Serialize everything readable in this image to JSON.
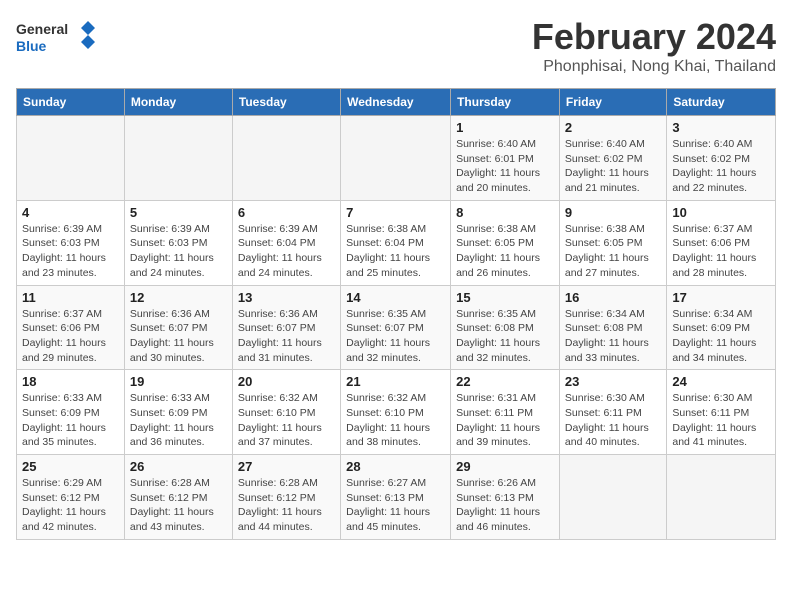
{
  "header": {
    "logo_general": "General",
    "logo_blue": "Blue",
    "title": "February 2024",
    "subtitle": "Phonphisai, Nong Khai, Thailand"
  },
  "weekdays": [
    "Sunday",
    "Monday",
    "Tuesday",
    "Wednesday",
    "Thursday",
    "Friday",
    "Saturday"
  ],
  "weeks": [
    [
      {
        "day": "",
        "detail": ""
      },
      {
        "day": "",
        "detail": ""
      },
      {
        "day": "",
        "detail": ""
      },
      {
        "day": "",
        "detail": ""
      },
      {
        "day": "1",
        "detail": "Sunrise: 6:40 AM\nSunset: 6:01 PM\nDaylight: 11 hours\nand 20 minutes."
      },
      {
        "day": "2",
        "detail": "Sunrise: 6:40 AM\nSunset: 6:02 PM\nDaylight: 11 hours\nand 21 minutes."
      },
      {
        "day": "3",
        "detail": "Sunrise: 6:40 AM\nSunset: 6:02 PM\nDaylight: 11 hours\nand 22 minutes."
      }
    ],
    [
      {
        "day": "4",
        "detail": "Sunrise: 6:39 AM\nSunset: 6:03 PM\nDaylight: 11 hours\nand 23 minutes."
      },
      {
        "day": "5",
        "detail": "Sunrise: 6:39 AM\nSunset: 6:03 PM\nDaylight: 11 hours\nand 24 minutes."
      },
      {
        "day": "6",
        "detail": "Sunrise: 6:39 AM\nSunset: 6:04 PM\nDaylight: 11 hours\nand 24 minutes."
      },
      {
        "day": "7",
        "detail": "Sunrise: 6:38 AM\nSunset: 6:04 PM\nDaylight: 11 hours\nand 25 minutes."
      },
      {
        "day": "8",
        "detail": "Sunrise: 6:38 AM\nSunset: 6:05 PM\nDaylight: 11 hours\nand 26 minutes."
      },
      {
        "day": "9",
        "detail": "Sunrise: 6:38 AM\nSunset: 6:05 PM\nDaylight: 11 hours\nand 27 minutes."
      },
      {
        "day": "10",
        "detail": "Sunrise: 6:37 AM\nSunset: 6:06 PM\nDaylight: 11 hours\nand 28 minutes."
      }
    ],
    [
      {
        "day": "11",
        "detail": "Sunrise: 6:37 AM\nSunset: 6:06 PM\nDaylight: 11 hours\nand 29 minutes."
      },
      {
        "day": "12",
        "detail": "Sunrise: 6:36 AM\nSunset: 6:07 PM\nDaylight: 11 hours\nand 30 minutes."
      },
      {
        "day": "13",
        "detail": "Sunrise: 6:36 AM\nSunset: 6:07 PM\nDaylight: 11 hours\nand 31 minutes."
      },
      {
        "day": "14",
        "detail": "Sunrise: 6:35 AM\nSunset: 6:07 PM\nDaylight: 11 hours\nand 32 minutes."
      },
      {
        "day": "15",
        "detail": "Sunrise: 6:35 AM\nSunset: 6:08 PM\nDaylight: 11 hours\nand 32 minutes."
      },
      {
        "day": "16",
        "detail": "Sunrise: 6:34 AM\nSunset: 6:08 PM\nDaylight: 11 hours\nand 33 minutes."
      },
      {
        "day": "17",
        "detail": "Sunrise: 6:34 AM\nSunset: 6:09 PM\nDaylight: 11 hours\nand 34 minutes."
      }
    ],
    [
      {
        "day": "18",
        "detail": "Sunrise: 6:33 AM\nSunset: 6:09 PM\nDaylight: 11 hours\nand 35 minutes."
      },
      {
        "day": "19",
        "detail": "Sunrise: 6:33 AM\nSunset: 6:09 PM\nDaylight: 11 hours\nand 36 minutes."
      },
      {
        "day": "20",
        "detail": "Sunrise: 6:32 AM\nSunset: 6:10 PM\nDaylight: 11 hours\nand 37 minutes."
      },
      {
        "day": "21",
        "detail": "Sunrise: 6:32 AM\nSunset: 6:10 PM\nDaylight: 11 hours\nand 38 minutes."
      },
      {
        "day": "22",
        "detail": "Sunrise: 6:31 AM\nSunset: 6:11 PM\nDaylight: 11 hours\nand 39 minutes."
      },
      {
        "day": "23",
        "detail": "Sunrise: 6:30 AM\nSunset: 6:11 PM\nDaylight: 11 hours\nand 40 minutes."
      },
      {
        "day": "24",
        "detail": "Sunrise: 6:30 AM\nSunset: 6:11 PM\nDaylight: 11 hours\nand 41 minutes."
      }
    ],
    [
      {
        "day": "25",
        "detail": "Sunrise: 6:29 AM\nSunset: 6:12 PM\nDaylight: 11 hours\nand 42 minutes."
      },
      {
        "day": "26",
        "detail": "Sunrise: 6:28 AM\nSunset: 6:12 PM\nDaylight: 11 hours\nand 43 minutes."
      },
      {
        "day": "27",
        "detail": "Sunrise: 6:28 AM\nSunset: 6:12 PM\nDaylight: 11 hours\nand 44 minutes."
      },
      {
        "day": "28",
        "detail": "Sunrise: 6:27 AM\nSunset: 6:13 PM\nDaylight: 11 hours\nand 45 minutes."
      },
      {
        "day": "29",
        "detail": "Sunrise: 6:26 AM\nSunset: 6:13 PM\nDaylight: 11 hours\nand 46 minutes."
      },
      {
        "day": "",
        "detail": ""
      },
      {
        "day": "",
        "detail": ""
      }
    ]
  ]
}
